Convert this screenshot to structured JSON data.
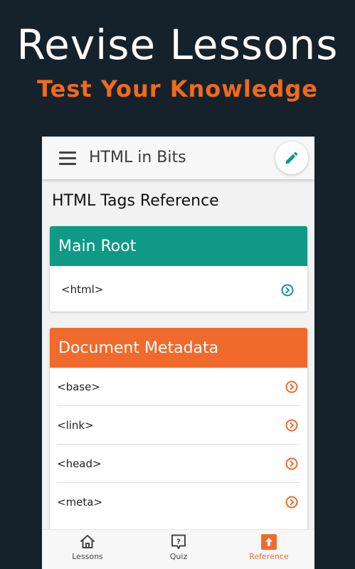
{
  "promo": {
    "title": "Revise Lessons",
    "subtitle": "Test Your Knowledge"
  },
  "appbar": {
    "title": "HTML in Bits",
    "menu_icon": "menu-icon",
    "edit_icon": "pencil-icon"
  },
  "page": {
    "heading": "HTML Tags Reference"
  },
  "cards": [
    {
      "title": "Main Root",
      "color": "#0f9a86",
      "items": [
        "<html>"
      ]
    },
    {
      "title": "Document Metadata",
      "color": "#f06a2c",
      "items": [
        "<base>",
        "<link>",
        "<head>",
        "<meta>"
      ]
    }
  ],
  "bottom_nav": {
    "items": [
      {
        "label": "Lessons",
        "icon": "home-icon"
      },
      {
        "label": "Quiz",
        "icon": "quiz-icon"
      },
      {
        "label": "Reference",
        "icon": "reference-icon",
        "active": true
      }
    ],
    "active_color": "#f06a2c"
  },
  "colors": {
    "background": "#15222c",
    "accent": "#f06a1c",
    "teal": "#0f9a86"
  }
}
